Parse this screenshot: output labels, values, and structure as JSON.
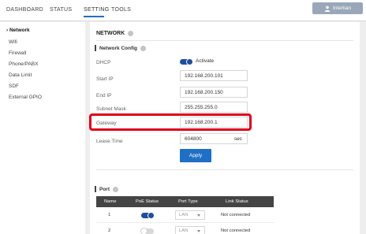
{
  "topnav": {
    "items": [
      "DASHBOARD",
      "STATUS",
      "SETTING",
      "TOOLS"
    ],
    "user_label": "Interlian"
  },
  "sidebar": {
    "items": [
      {
        "label": "Network",
        "active": true
      },
      {
        "label": "Wifi"
      },
      {
        "label": "Firewall"
      },
      {
        "label": "Phone/PABX"
      },
      {
        "label": "Data Limit"
      },
      {
        "label": "SDF"
      },
      {
        "label": "External GPIO"
      }
    ]
  },
  "network": {
    "title": "NETWORK",
    "config_title": "Network Config",
    "dhcp": {
      "label": "DHCP",
      "toggle_label": "Activate",
      "on": true
    },
    "start_ip": {
      "label": "Start IP",
      "value": "192.168.200.101"
    },
    "end_ip": {
      "label": "End IP",
      "value": "192.168.200.150"
    },
    "subnet": {
      "label": "Subnet Mask",
      "value": "255.255.255.0"
    },
    "gateway": {
      "label": "Gateway",
      "value": "192.168.200.1"
    },
    "lease": {
      "label": "Lease Time",
      "value": "604800",
      "unit": "sec"
    },
    "apply_label": "Apply"
  },
  "port": {
    "title": "Port",
    "headers": [
      "Name",
      "PoE Status",
      "Port Type",
      "Link Status"
    ],
    "rows": [
      {
        "name": "1",
        "poe_on": true,
        "type": "LAN",
        "link": "Not connected"
      },
      {
        "name": "2",
        "poe_on": false,
        "type": "LAN",
        "link": "Not connected"
      }
    ]
  },
  "colors": {
    "accent": "#1f6fc5",
    "highlight": "#e0001b",
    "table_header": "#444444"
  }
}
